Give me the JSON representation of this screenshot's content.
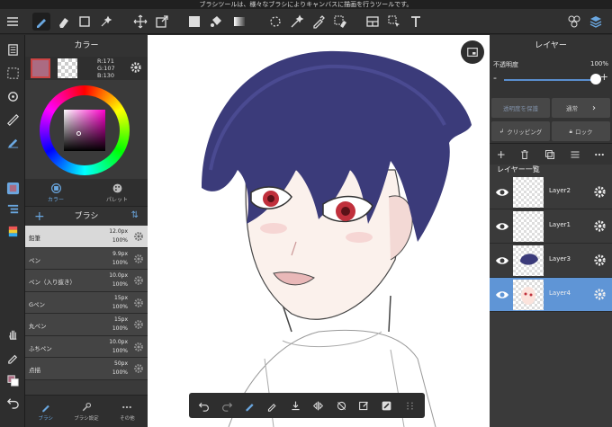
{
  "tooltip": "ブラシツールは、様々なブラシによりキャンバスに描画を行うツールです。",
  "color_panel": {
    "title": "カラー",
    "rgb": {
      "r": "R:171",
      "g": "G:107",
      "b": "B:130"
    },
    "main_color": "#ab6b82",
    "tabs": [
      {
        "label": "カラー"
      },
      {
        "label": "パレット"
      }
    ]
  },
  "brush_panel": {
    "title": "ブラシ",
    "brushes": [
      {
        "name": "鉛筆",
        "size": "12.0px",
        "opacity": "100%",
        "selected": true
      },
      {
        "name": "ペン",
        "size": "9.9px",
        "opacity": "100%"
      },
      {
        "name": "ペン（入り抜き）",
        "size": "10.0px",
        "opacity": "100%"
      },
      {
        "name": "Gペン",
        "size": "15px",
        "opacity": "100%"
      },
      {
        "name": "丸ペン",
        "size": "15px",
        "opacity": "100%"
      },
      {
        "name": "ふちペン",
        "size": "10.0px",
        "opacity": "100%"
      },
      {
        "name": "点描",
        "size": "50px",
        "opacity": "100%"
      }
    ],
    "bottom_tabs": [
      {
        "label": "ブラシ"
      },
      {
        "label": "ブラシ設定"
      },
      {
        "label": "その他"
      }
    ]
  },
  "layer_panel": {
    "title": "レイヤー",
    "opacity_label": "不透明度",
    "opacity_value": "100%",
    "protect_alpha": "透明度を保護",
    "blend_mode": "通常",
    "clipping": "クリッピング",
    "lock": "ロック",
    "list_title": "レイヤー一覧",
    "layers": [
      {
        "name": "Layer2",
        "selected": false
      },
      {
        "name": "Layer1",
        "selected": false
      },
      {
        "name": "Layer3",
        "selected": false
      },
      {
        "name": "Layer4",
        "selected": true
      }
    ]
  },
  "colors": {
    "accent": "#5f95d6",
    "hair": "#3b3b7a",
    "eye": "#c0303c"
  }
}
